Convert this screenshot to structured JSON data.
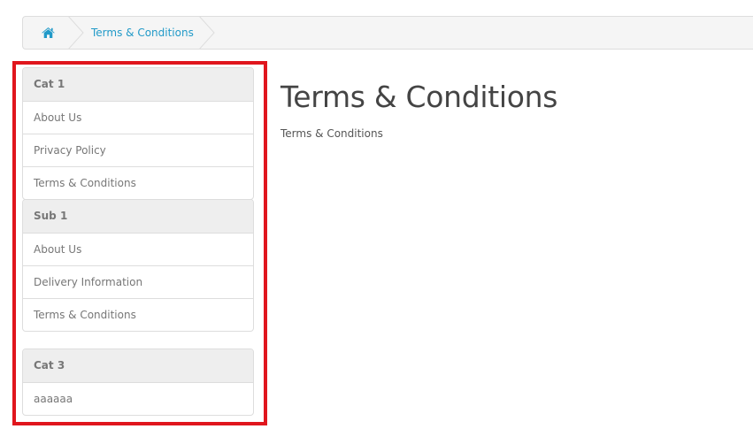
{
  "breadcrumb": {
    "home_icon": "home-icon",
    "current": "Terms & Conditions"
  },
  "sidebar": {
    "group1": [
      {
        "label": "Cat 1",
        "type": "header"
      },
      {
        "label": "About Us",
        "type": "link"
      },
      {
        "label": "Privacy Policy",
        "type": "link"
      },
      {
        "label": "Terms & Conditions",
        "type": "link"
      }
    ],
    "group2": [
      {
        "label": "Sub 1",
        "type": "header"
      },
      {
        "label": "About Us",
        "type": "link"
      },
      {
        "label": "Delivery Information",
        "type": "link"
      },
      {
        "label": "Terms & Conditions",
        "type": "link"
      }
    ],
    "group3": [
      {
        "label": "Cat 3",
        "type": "header"
      },
      {
        "label": "aaaaaa",
        "type": "link"
      }
    ],
    "highlight_color": "#e0161d"
  },
  "content": {
    "title": "Terms & Conditions",
    "body": "Terms & Conditions"
  },
  "colors": {
    "link": "#229ac8",
    "border": "#dddddd",
    "header_bg": "#eeeeee"
  }
}
